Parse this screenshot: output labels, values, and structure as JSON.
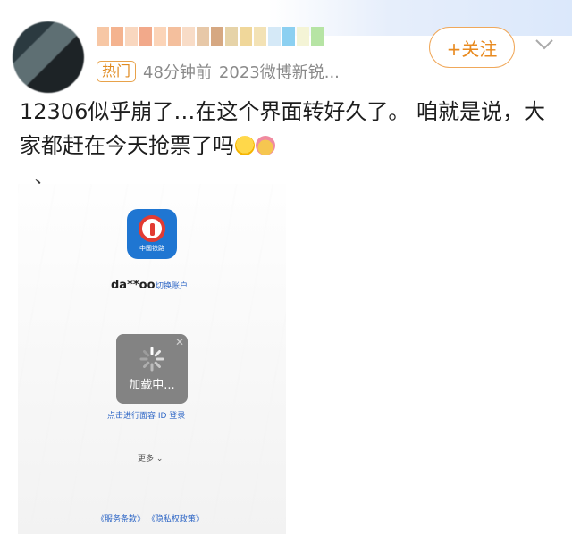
{
  "post": {
    "badge": "热门",
    "time": "48分钟前",
    "source": "2023微博新锐...",
    "follow_label": "+关注",
    "text": "12306似乎崩了…在这个界面转好久了。 咱就是说，大家都赶在今天抢票了吗",
    "trailing": "、"
  },
  "app": {
    "icon_label": "中国铁路",
    "account": "da**oo",
    "switch_label": "切换账户",
    "loading_text": "加载中...",
    "faceid_label": "点击进行面容 ID 登录",
    "more_label": "更多",
    "links": "《服务条款》 《隐私权政策》"
  },
  "colors": {
    "follow": "#e88a1f",
    "link": "#2f67c6",
    "app_blue": "#1f76d2",
    "logo_red": "#e23b33"
  }
}
